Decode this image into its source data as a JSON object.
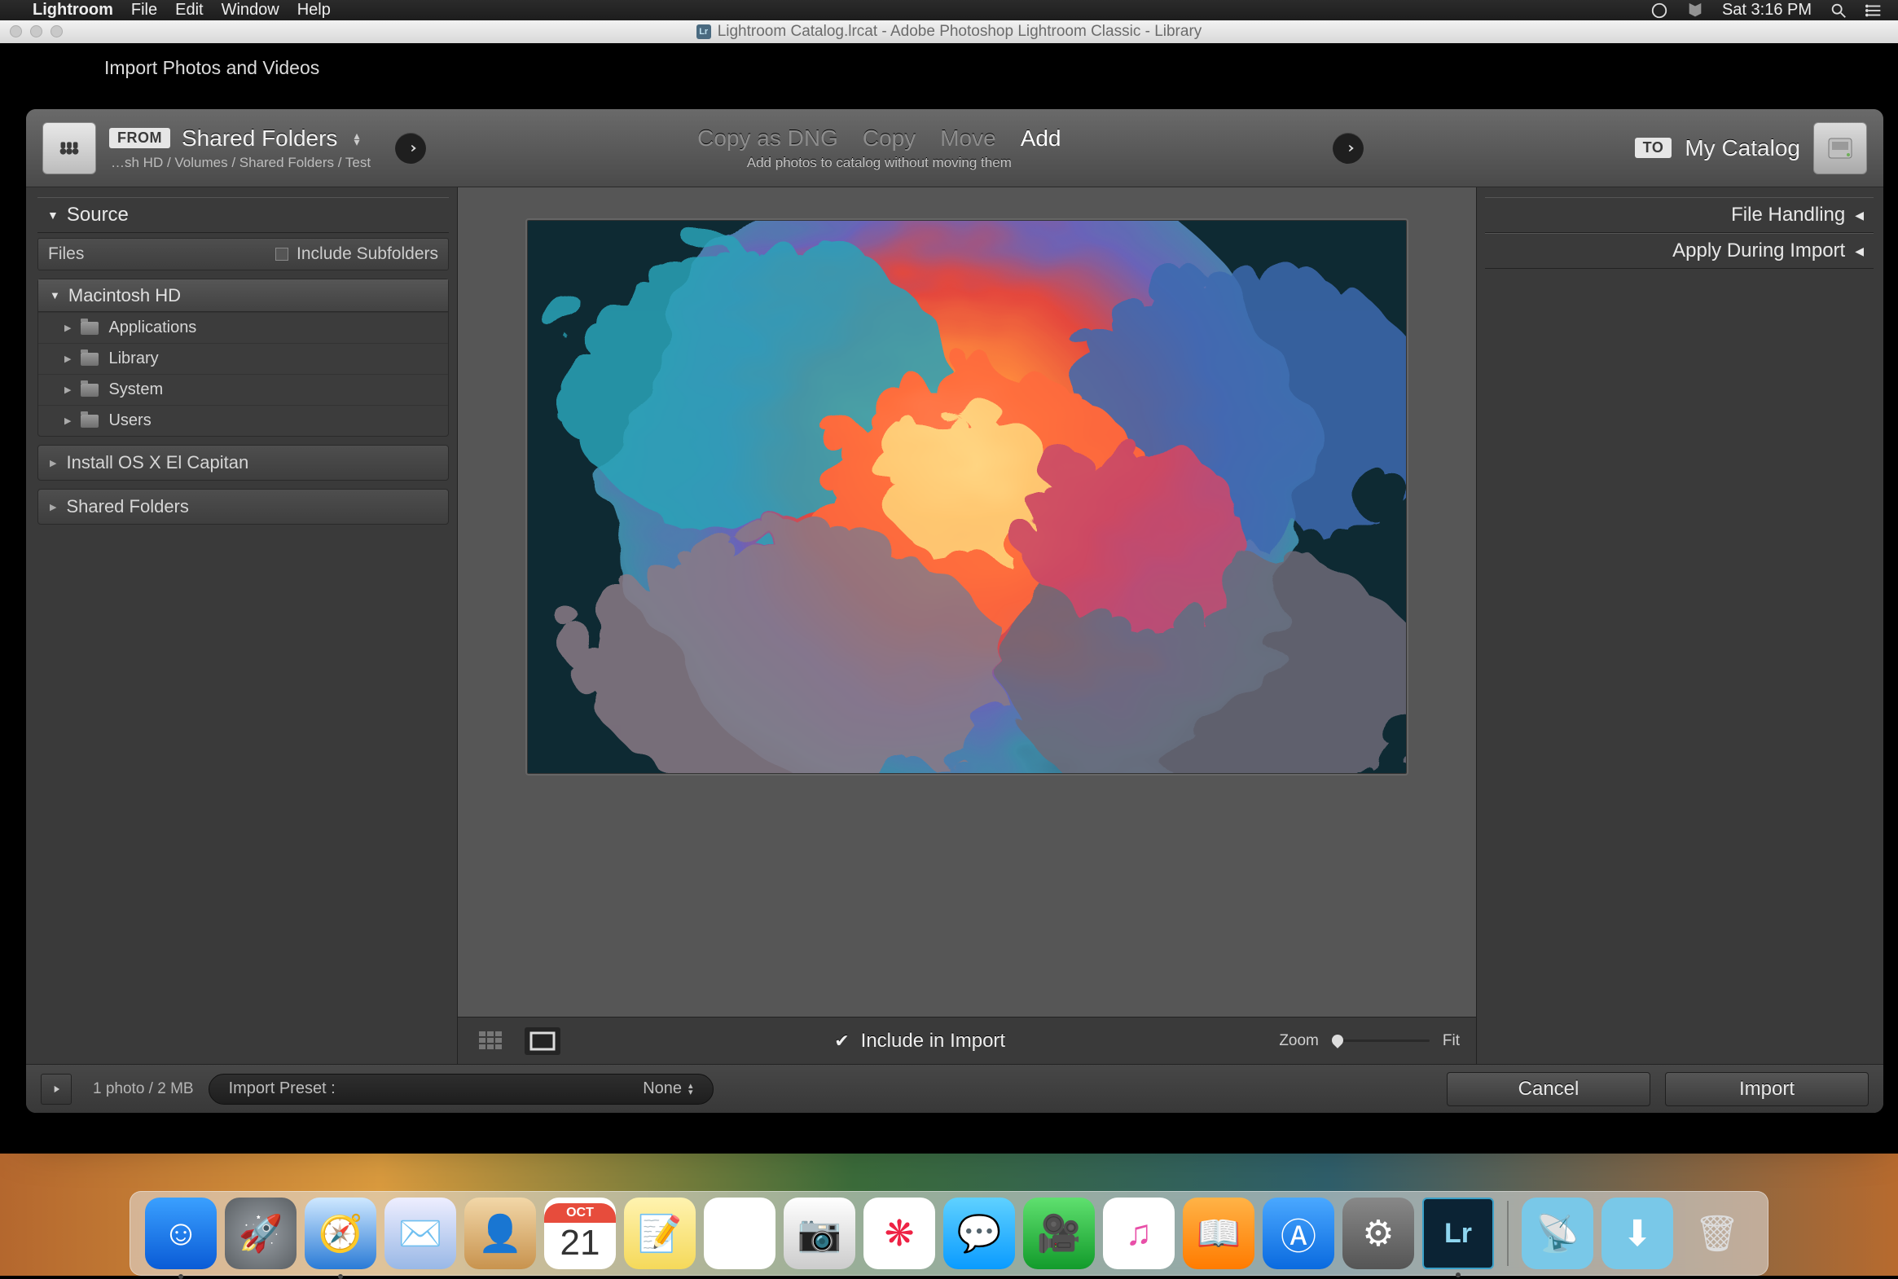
{
  "menubar": {
    "app": "Lightroom",
    "items": [
      "File",
      "Edit",
      "Window",
      "Help"
    ],
    "clock": "Sat 3:16 PM"
  },
  "titlebar": {
    "title": "Lightroom Catalog.lrcat - Adobe Photoshop Lightroom Classic - Library",
    "badge": "Lr"
  },
  "peek": "Import Photos and Videos",
  "header": {
    "from_badge": "FROM",
    "from_title": "Shared Folders",
    "from_path": "…sh HD / Volumes / Shared Folders / Test",
    "modes": [
      "Copy as DNG",
      "Copy",
      "Move",
      "Add"
    ],
    "mode_active": 3,
    "mode_sub": "Add photos to catalog without moving them",
    "to_badge": "TO",
    "to_title": "My Catalog"
  },
  "left": {
    "source": "Source",
    "files": "Files",
    "include_sub": "Include Subfolders",
    "root": "Macintosh HD",
    "children": [
      "Applications",
      "Library",
      "System",
      "Users"
    ],
    "volumes": [
      "Install OS X El Capitan",
      "Shared Folders"
    ]
  },
  "right": {
    "sections": [
      "File Handling",
      "Apply During Import"
    ]
  },
  "center": {
    "include": "Include in Import",
    "zoom": "Zoom",
    "fit": "Fit"
  },
  "foot": {
    "count": "1 photo / 2 MB",
    "preset_label": "Import Preset :",
    "preset_value": "None",
    "cancel": "Cancel",
    "import": "Import"
  },
  "dock": {
    "apps": [
      {
        "name": "finder",
        "bg": "linear-gradient(#3aa0ff,#0a5bd6)",
        "glyph": "☺",
        "running": true
      },
      {
        "name": "launchpad",
        "bg": "radial-gradient(circle,#9aa0a6,#5a5f63)",
        "glyph": "🚀"
      },
      {
        "name": "safari",
        "bg": "linear-gradient(#cfe8ff,#2a7bd6)",
        "glyph": "🧭",
        "running": true
      },
      {
        "name": "mail",
        "bg": "linear-gradient(#eef,#99b8e6)",
        "glyph": "✉️"
      },
      {
        "name": "contacts",
        "bg": "linear-gradient(#f2d7a8,#c8934e)",
        "glyph": "👤"
      },
      {
        "name": "calendar",
        "bg": "#fff",
        "glyph": "21",
        "text": "#d33",
        "header": "OCT"
      },
      {
        "name": "notes",
        "bg": "linear-gradient(#fff3b0,#f5d95a)",
        "glyph": "📝"
      },
      {
        "name": "reminders",
        "bg": "#fff",
        "glyph": "▥"
      },
      {
        "name": "photobooth",
        "bg": "linear-gradient(#fff,#ccc)",
        "glyph": "📷"
      },
      {
        "name": "photos",
        "bg": "#fff",
        "glyph": "❋",
        "text": "#e24"
      },
      {
        "name": "messages",
        "bg": "linear-gradient(#5fd1ff,#0a9bff)",
        "glyph": "💬"
      },
      {
        "name": "facetime",
        "bg": "linear-gradient(#5fe06f,#129b2b)",
        "glyph": "🎥"
      },
      {
        "name": "itunes",
        "bg": "#fff",
        "glyph": "♫",
        "text": "#e84fa8"
      },
      {
        "name": "ibooks",
        "bg": "linear-gradient(#ffb347,#ff7b00)",
        "glyph": "📖"
      },
      {
        "name": "appstore",
        "bg": "linear-gradient(#4aa8ff,#0a6adf)",
        "glyph": "Ⓐ"
      },
      {
        "name": "sysprefs",
        "bg": "linear-gradient(#888,#555)",
        "glyph": "⚙"
      },
      {
        "name": "lightroom",
        "bg": "#0b2334",
        "glyph": "Lr",
        "text": "#8fd6f0",
        "running": true
      }
    ],
    "right": [
      {
        "name": "airdrop",
        "bg": "#79c8e8",
        "glyph": "📡"
      },
      {
        "name": "downloads",
        "bg": "#79c8e8",
        "glyph": "⬇"
      },
      {
        "name": "trash",
        "bg": "transparent",
        "glyph": "🗑",
        "text": "#ddd"
      }
    ]
  }
}
